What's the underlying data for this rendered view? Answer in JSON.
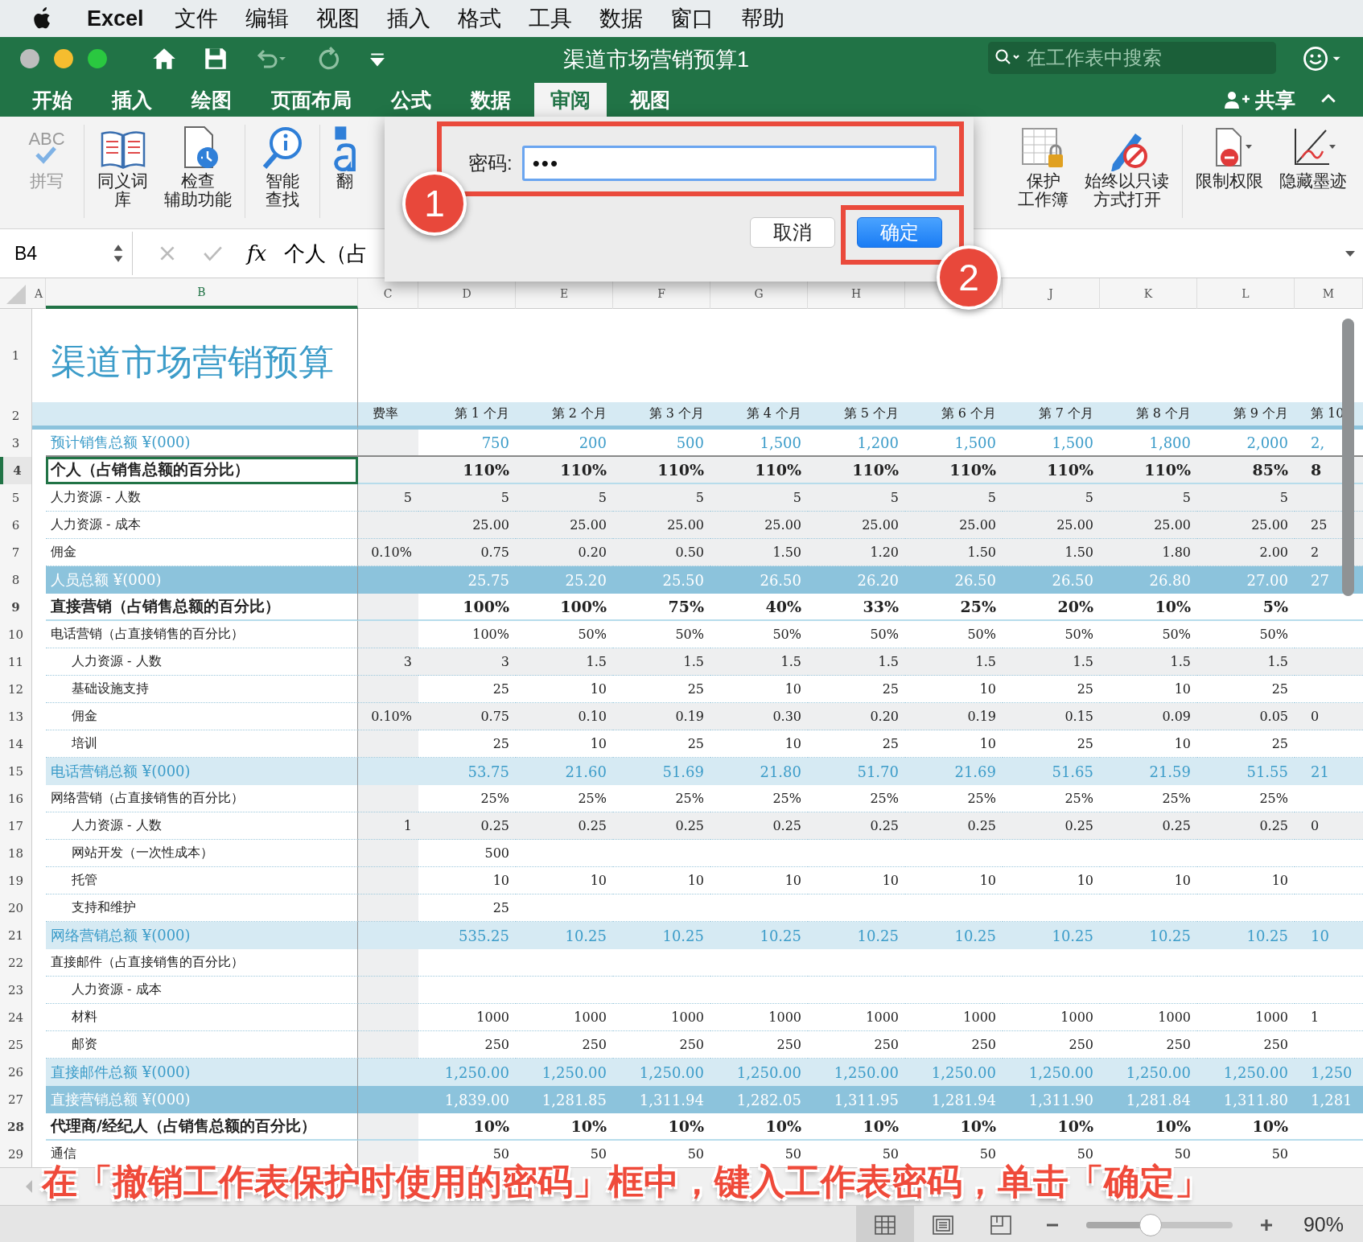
{
  "menu_bar": {
    "app_name": "Excel",
    "items": [
      "文件",
      "编辑",
      "视图",
      "插入",
      "格式",
      "工具",
      "数据",
      "窗口",
      "帮助"
    ]
  },
  "window": {
    "title": "渠道市场营销预算1",
    "search": {
      "placeholder": "在工作表中搜索"
    }
  },
  "tabs": [
    {
      "label": "开始",
      "selected": false
    },
    {
      "label": "插入",
      "selected": false
    },
    {
      "label": "绘图",
      "selected": false
    },
    {
      "label": "页面布局",
      "selected": false
    },
    {
      "label": "公式",
      "selected": false
    },
    {
      "label": "数据",
      "selected": false
    },
    {
      "label": "审阅",
      "selected": true
    },
    {
      "label": "视图",
      "selected": false
    }
  ],
  "share": {
    "label": "共享"
  },
  "ribbon": [
    {
      "kind": "spelling",
      "icon_text": "ABC",
      "lines": [
        "拼写"
      ],
      "disabled": true
    },
    {
      "kind": "thesaurus",
      "lines": [
        "同义词",
        "库"
      ],
      "disabled": false
    },
    {
      "kind": "accessibility",
      "lines": [
        "检查",
        "辅助功能"
      ],
      "disabled": false
    },
    {
      "kind": "lookup",
      "lines": [
        "智能",
        "查找"
      ],
      "disabled": false
    },
    {
      "kind": "translate",
      "lines": [
        "翻"
      ],
      "disabled": false
    },
    {
      "kind": "protect",
      "lines": [
        "保护",
        "工作簿"
      ],
      "disabled": false
    },
    {
      "kind": "readonly",
      "lines": [
        "始终以只读",
        "方式打开"
      ],
      "disabled": false
    },
    {
      "kind": "permission",
      "lines": [
        "限制权限"
      ],
      "disabled": false
    },
    {
      "kind": "ink",
      "lines": [
        "隐藏墨迹"
      ],
      "disabled": false
    }
  ],
  "formula_bar": {
    "cell": "B4",
    "fx": "fx",
    "content": "个人（占"
  },
  "columns": [
    {
      "letter": "A",
      "selected": false
    },
    {
      "letter": "B",
      "selected": true
    },
    {
      "letter": "C",
      "selected": false
    },
    {
      "letter": "D",
      "selected": false
    },
    {
      "letter": "E",
      "selected": false
    },
    {
      "letter": "F",
      "selected": false
    },
    {
      "letter": "G",
      "selected": false
    },
    {
      "letter": "H",
      "selected": false
    },
    {
      "selected": false
    },
    {
      "letter": "J",
      "selected": false
    },
    {
      "letter": "K",
      "selected": false
    },
    {
      "letter": "L",
      "selected": false
    },
    {
      "letter": "M",
      "selected": false
    }
  ],
  "rows": [
    {
      "number": "1",
      "kind": "title",
      "label": "渠道市场营销预算",
      "selected": false,
      "shaded": false,
      "values": []
    },
    {
      "number": "2",
      "kind": "header",
      "rate": "费率",
      "selected": false,
      "shaded": false,
      "values": [
        "第 1 个月",
        "第 2 个月",
        "第 3 个月",
        "第 4 个月",
        "第 5 个月",
        "第 6 个月",
        "第 7 个月",
        "第 8 个月",
        "第 9 个月",
        "第 10"
      ]
    },
    {
      "number": "3",
      "kind": "forecast",
      "label": "预计销售总额 ¥(000)",
      "selected": false,
      "shaded": false,
      "values": [
        "750",
        "200",
        "500",
        "1,500",
        "1,200",
        "1,500",
        "1,500",
        "1,800",
        "2,000",
        "2,"
      ]
    },
    {
      "number": "4",
      "kind": "section",
      "label": "个人（占销售总额的百分比）",
      "selected": true,
      "shaded": true,
      "values": [
        "110%",
        "110%",
        "110%",
        "110%",
        "110%",
        "110%",
        "110%",
        "110%",
        "85%",
        "8"
      ]
    },
    {
      "number": "5",
      "kind": "item",
      "label": "人力资源 - 人数",
      "rate": "5",
      "selected": false,
      "shaded": true,
      "values": [
        "5",
        "5",
        "5",
        "5",
        "5",
        "5",
        "5",
        "5",
        "5"
      ]
    },
    {
      "number": "6",
      "kind": "item",
      "label": "人力资源 - 成本",
      "selected": false,
      "shaded": true,
      "values": [
        "25.00",
        "25.00",
        "25.00",
        "25.00",
        "25.00",
        "25.00",
        "25.00",
        "25.00",
        "25.00",
        "25"
      ]
    },
    {
      "number": "7",
      "kind": "item",
      "label": "佣金",
      "rate": "0.10%",
      "selected": false,
      "shaded": true,
      "values": [
        "0.75",
        "0.20",
        "0.50",
        "1.50",
        "1.20",
        "1.50",
        "1.50",
        "1.80",
        "2.00",
        "2"
      ]
    },
    {
      "number": "8",
      "kind": "dark",
      "label": "人员总额 ¥(000)",
      "selected": false,
      "shaded": false,
      "values": [
        "25.75",
        "25.20",
        "25.50",
        "26.50",
        "26.20",
        "26.50",
        "26.50",
        "26.80",
        "27.00",
        "27"
      ]
    },
    {
      "number": "9",
      "kind": "section",
      "label": "直接营销（占销售总额的百分比）",
      "selected": false,
      "shaded": false,
      "values": [
        "100%",
        "100%",
        "75%",
        "40%",
        "33%",
        "25%",
        "20%",
        "10%",
        "5%"
      ]
    },
    {
      "number": "10",
      "kind": "item",
      "label": "电话营销（占直接销售的百分比）",
      "selected": false,
      "shaded": false,
      "values": [
        "100%",
        "50%",
        "50%",
        "50%",
        "50%",
        "50%",
        "50%",
        "50%",
        "50%"
      ]
    },
    {
      "number": "11",
      "kind": "subitem",
      "label": "人力资源 - 人数",
      "rate": "3",
      "selected": false,
      "shaded": true,
      "values": [
        "3",
        "1.5",
        "1.5",
        "1.5",
        "1.5",
        "1.5",
        "1.5",
        "1.5",
        "1.5"
      ]
    },
    {
      "number": "12",
      "kind": "subitem",
      "label": "基础设施支持",
      "selected": false,
      "shaded": false,
      "values": [
        "25",
        "10",
        "25",
        "10",
        "25",
        "10",
        "25",
        "10",
        "25"
      ]
    },
    {
      "number": "13",
      "kind": "subitem",
      "label": "佣金",
      "rate": "0.10%",
      "selected": false,
      "shaded": true,
      "values": [
        "0.75",
        "0.10",
        "0.19",
        "0.30",
        "0.20",
        "0.19",
        "0.15",
        "0.09",
        "0.05",
        "0"
      ]
    },
    {
      "number": "14",
      "kind": "subitem",
      "label": "培训",
      "selected": false,
      "shaded": false,
      "values": [
        "25",
        "10",
        "25",
        "10",
        "25",
        "10",
        "25",
        "10",
        "25"
      ]
    },
    {
      "number": "15",
      "kind": "band",
      "label": "电话营销总额 ¥(000)",
      "selected": false,
      "shaded": false,
      "values": [
        "53.75",
        "21.60",
        "51.69",
        "21.80",
        "51.70",
        "21.69",
        "51.65",
        "21.59",
        "51.55",
        "21"
      ]
    },
    {
      "number": "16",
      "kind": "item",
      "label": "网络营销（占直接销售的百分比）",
      "selected": false,
      "shaded": false,
      "values": [
        "25%",
        "25%",
        "25%",
        "25%",
        "25%",
        "25%",
        "25%",
        "25%",
        "25%"
      ]
    },
    {
      "number": "17",
      "kind": "subitem",
      "label": "人力资源 - 人数",
      "rate": "1",
      "selected": false,
      "shaded": true,
      "values": [
        "0.25",
        "0.25",
        "0.25",
        "0.25",
        "0.25",
        "0.25",
        "0.25",
        "0.25",
        "0.25",
        "0"
      ]
    },
    {
      "number": "18",
      "kind": "subitem",
      "label": "网站开发（一次性成本）",
      "selected": false,
      "shaded": false,
      "values": [
        "500"
      ]
    },
    {
      "number": "19",
      "kind": "subitem",
      "label": "托管",
      "selected": false,
      "shaded": false,
      "values": [
        "10",
        "10",
        "10",
        "10",
        "10",
        "10",
        "10",
        "10",
        "10"
      ]
    },
    {
      "number": "20",
      "kind": "subitem",
      "label": "支持和维护",
      "selected": false,
      "shaded": false,
      "values": [
        "25"
      ]
    },
    {
      "number": "21",
      "kind": "band",
      "label": "网络营销总额 ¥(000)",
      "selected": false,
      "shaded": false,
      "values": [
        "535.25",
        "10.25",
        "10.25",
        "10.25",
        "10.25",
        "10.25",
        "10.25",
        "10.25",
        "10.25",
        "10"
      ]
    },
    {
      "number": "22",
      "kind": "item",
      "label": "直接邮件（占直接销售的百分比）",
      "selected": false,
      "shaded": false,
      "values": []
    },
    {
      "number": "23",
      "kind": "subitem",
      "label": "人力资源 - 成本",
      "selected": false,
      "shaded": false,
      "values": []
    },
    {
      "number": "24",
      "kind": "subitem",
      "label": "材料",
      "selected": false,
      "shaded": false,
      "values": [
        "1000",
        "1000",
        "1000",
        "1000",
        "1000",
        "1000",
        "1000",
        "1000",
        "1000",
        "1"
      ]
    },
    {
      "number": "25",
      "kind": "subitem",
      "label": "邮资",
      "selected": false,
      "shaded": false,
      "values": [
        "250",
        "250",
        "250",
        "250",
        "250",
        "250",
        "250",
        "250",
        "250"
      ]
    },
    {
      "number": "26",
      "kind": "band",
      "label": "直接邮件总额 ¥(000)",
      "selected": false,
      "shaded": false,
      "values": [
        "1,250.00",
        "1,250.00",
        "1,250.00",
        "1,250.00",
        "1,250.00",
        "1,250.00",
        "1,250.00",
        "1,250.00",
        "1,250.00",
        "1,250"
      ]
    },
    {
      "number": "27",
      "kind": "dark",
      "label": "直接营销总额 ¥(000)",
      "selected": false,
      "shaded": false,
      "values": [
        "1,839.00",
        "1,281.85",
        "1,311.94",
        "1,282.05",
        "1,311.95",
        "1,281.94",
        "1,311.90",
        "1,281.84",
        "1,311.80",
        "1,281"
      ]
    },
    {
      "number": "28",
      "kind": "section",
      "label": "代理商/经纪人（占销售总额的百分比）",
      "selected": false,
      "shaded": false,
      "values": [
        "10%",
        "10%",
        "10%",
        "10%",
        "10%",
        "10%",
        "10%",
        "10%",
        "10%"
      ]
    },
    {
      "number": "29",
      "kind": "item",
      "label": "通信",
      "selected": false,
      "shaded": false,
      "values": [
        "50",
        "50",
        "50",
        "50",
        "50",
        "50",
        "50",
        "50",
        "50"
      ]
    }
  ],
  "dialog": {
    "label": "密码:",
    "value": "•••",
    "buttons": [
      {
        "label": "取消",
        "kind": "cancel"
      },
      {
        "label": "确定",
        "kind": "default"
      }
    ]
  },
  "annotations": [
    {
      "number": "1"
    },
    {
      "number": "2"
    }
  ],
  "caption": "在「撤销工作表保护时使用的密码」框中，键入工作表密码，单击「确定」",
  "status_bar": {
    "views": [
      {
        "selected": true
      },
      {
        "selected": false
      },
      {
        "selected": false
      }
    ],
    "zoom": {
      "level": 0.45,
      "reading": "90%"
    }
  }
}
